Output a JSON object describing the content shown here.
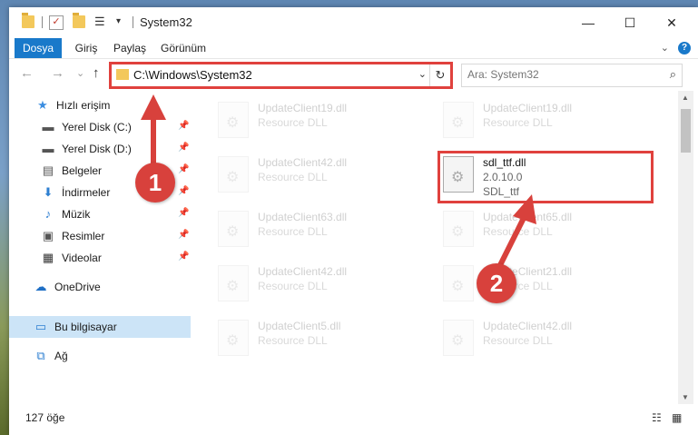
{
  "window": {
    "title": "System32",
    "controls": {
      "minimize": "—",
      "maximize": "☐",
      "close": "✕"
    }
  },
  "ribbon": {
    "tabs": [
      "Dosya",
      "Giriş",
      "Paylaş",
      "Görünüm"
    ],
    "expand_glyph": "⌄",
    "help_glyph": "?"
  },
  "nav": {
    "back_glyph": "←",
    "forward_glyph": "→",
    "recent_glyph": "⌄",
    "up_glyph": "↑",
    "address": "C:\\Windows\\System32",
    "address_drop_glyph": "⌄",
    "refresh_glyph": "↻",
    "search_placeholder": "Ara: System32",
    "search_glyph": "⌕"
  },
  "sidebar": {
    "items": [
      {
        "label": "Hızlı erişim",
        "icon": "star-icon",
        "glyph": "★",
        "color": "#3b8de0"
      },
      {
        "label": "Yerel Disk (C:)",
        "icon": "drive-icon",
        "glyph": "▬",
        "color": "#555555",
        "pinned": true
      },
      {
        "label": "Yerel Disk (D:)",
        "icon": "drive-icon",
        "glyph": "▬",
        "color": "#555555",
        "pinned": true
      },
      {
        "label": "Belgeler",
        "icon": "document-icon",
        "glyph": "▤",
        "color": "#555555",
        "pinned": true
      },
      {
        "label": "İndirmeler",
        "icon": "download-icon",
        "glyph": "⬇",
        "color": "#2d7fd1",
        "pinned": true
      },
      {
        "label": "Müzik",
        "icon": "music-icon",
        "glyph": "♪",
        "color": "#2d7fd1",
        "pinned": true
      },
      {
        "label": "Resimler",
        "icon": "pictures-icon",
        "glyph": "▣",
        "color": "#555555",
        "pinned": true
      },
      {
        "label": "Videolar",
        "icon": "video-icon",
        "glyph": "▦",
        "color": "#333333",
        "pinned": true
      },
      {
        "label": "OneDrive",
        "icon": "cloud-icon",
        "glyph": "☁",
        "color": "#1f6fc5"
      },
      {
        "label": "Bu bilgisayar",
        "icon": "computer-icon",
        "glyph": "▭",
        "color": "#2d7fd1",
        "selected": true
      },
      {
        "label": "Ağ",
        "icon": "network-icon",
        "glyph": "⧉",
        "color": "#2d7fd1"
      }
    ],
    "pin_glyph": "📌"
  },
  "files": [
    {
      "name": "UpdateClient19.dll",
      "desc": "Resource DLL",
      "faded": true
    },
    {
      "name": "UpdateClient19.dll",
      "desc": "Resource DLL",
      "faded": true
    },
    {
      "name": "UpdateClient42.dll",
      "desc": "Resource DLL",
      "faded": true
    },
    {
      "name": "sdl_ttf.dll",
      "desc": "2.0.10.0",
      "desc2": "SDL_ttf",
      "faded": false
    },
    {
      "name": "UpdateClient63.dll",
      "desc": "Resource DLL",
      "faded": true
    },
    {
      "name": "UpdateClient65.dll",
      "desc": "Resource DLL",
      "faded": true
    },
    {
      "name": "UpdateClient42.dll",
      "desc": "Resource DLL",
      "faded": true
    },
    {
      "name": "UpdateClient21.dll",
      "desc": "Resource DLL",
      "faded": true
    },
    {
      "name": "UpdateClient5.dll",
      "desc": "Resource DLL",
      "faded": true
    },
    {
      "name": "UpdateClient42.dll",
      "desc": "Resource DLL",
      "faded": true
    }
  ],
  "status": {
    "item_count": "127 öğe"
  },
  "annotations": {
    "callout_1": "1",
    "callout_2": "2",
    "accent_color": "#e0413d"
  }
}
